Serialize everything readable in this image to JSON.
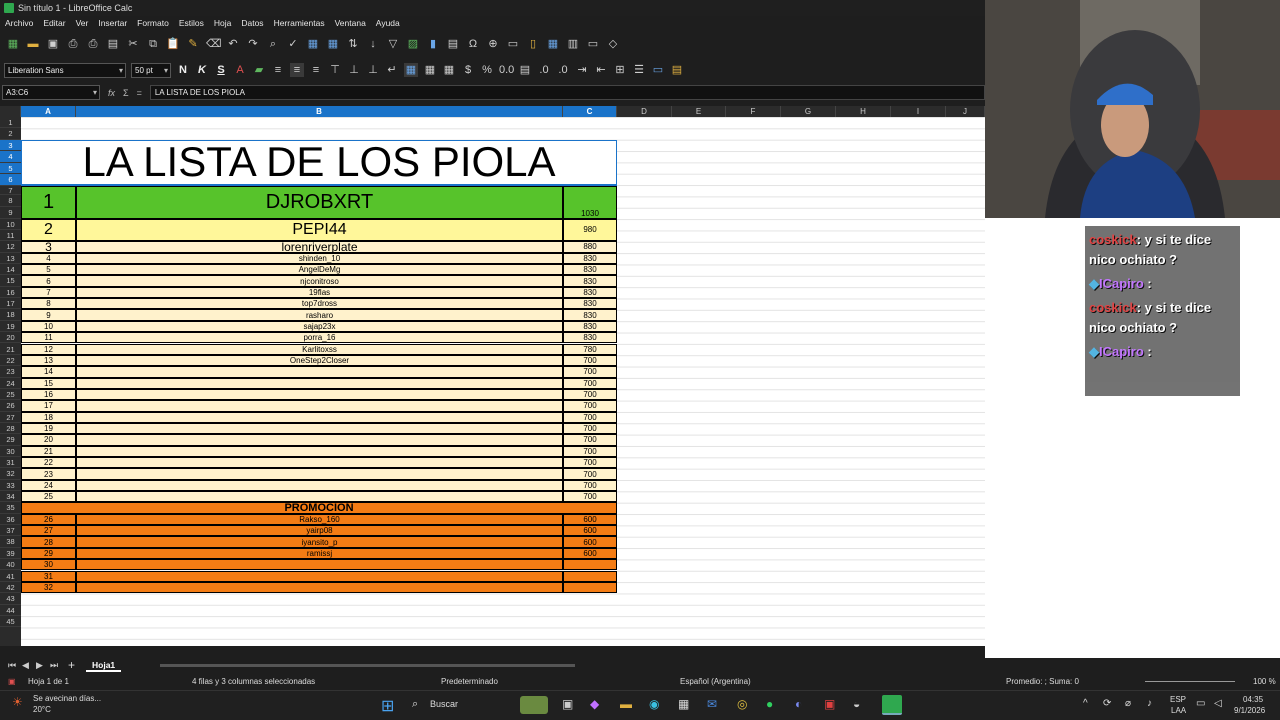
{
  "window": {
    "title": "Sin título 1 - LibreOffice Calc"
  },
  "menu": [
    "Archivo",
    "Editar",
    "Ver",
    "Insertar",
    "Formato",
    "Estilos",
    "Hoja",
    "Datos",
    "Herramientas",
    "Ventana",
    "Ayuda"
  ],
  "toolbar": {
    "font_name": "Liberation Sans",
    "font_size": "50 pt"
  },
  "formula": {
    "cell_ref": "A3:C6",
    "content": "LA LISTA DE LOS PIOLA"
  },
  "columns": [
    "A",
    "B",
    "C",
    "D",
    "E",
    "F",
    "G",
    "H",
    "I",
    "J"
  ],
  "rows": [
    "1",
    "2",
    "3",
    "4",
    "5",
    "6",
    "7",
    "8",
    "9",
    "10",
    "11",
    "12",
    "13",
    "14",
    "15",
    "16",
    "17",
    "18",
    "19",
    "20",
    "21",
    "22",
    "23",
    "24",
    "25",
    "26",
    "27",
    "28",
    "29",
    "30",
    "31",
    "32",
    "33",
    "34",
    "35",
    "36",
    "37",
    "38",
    "39",
    "40",
    "41",
    "42",
    "43",
    "44",
    "45"
  ],
  "sheet": {
    "title": "LA LISTA DE LOS PIOLA",
    "top3": [
      {
        "rank": "1",
        "name": "DJROBXRT",
        "score": "1030"
      },
      {
        "rank": "2",
        "name": "PEPI44",
        "score": "980"
      },
      {
        "rank": "3",
        "name": "lorenriverplate",
        "score": "880"
      }
    ],
    "list": [
      {
        "rank": "4",
        "name": "shinden_10",
        "score": "830"
      },
      {
        "rank": "5",
        "name": "AngelDeMg",
        "score": "830"
      },
      {
        "rank": "6",
        "name": "njconitroso",
        "score": "830"
      },
      {
        "rank": "7",
        "name": "19flas",
        "score": "830"
      },
      {
        "rank": "8",
        "name": "top7dross",
        "score": "830"
      },
      {
        "rank": "9",
        "name": "rasharo",
        "score": "830"
      },
      {
        "rank": "10",
        "name": "sajap23x",
        "score": "830"
      },
      {
        "rank": "11",
        "name": "porra_16",
        "score": "830"
      },
      {
        "rank": "12",
        "name": "Karlitoxss",
        "score": "780"
      },
      {
        "rank": "13",
        "name": "OneStep2Closer",
        "score": "700"
      },
      {
        "rank": "14",
        "name": "",
        "score": "700"
      },
      {
        "rank": "15",
        "name": "",
        "score": "700"
      },
      {
        "rank": "16",
        "name": "",
        "score": "700"
      },
      {
        "rank": "17",
        "name": "",
        "score": "700"
      },
      {
        "rank": "18",
        "name": "",
        "score": "700"
      },
      {
        "rank": "19",
        "name": "",
        "score": "700"
      },
      {
        "rank": "20",
        "name": "",
        "score": "700"
      },
      {
        "rank": "21",
        "name": "",
        "score": "700"
      },
      {
        "rank": "22",
        "name": "",
        "score": "700"
      },
      {
        "rank": "23",
        "name": "",
        "score": "700"
      },
      {
        "rank": "24",
        "name": "",
        "score": "700"
      },
      {
        "rank": "25",
        "name": "",
        "score": "700"
      }
    ],
    "promo_title": "PROMOCION",
    "promo": [
      {
        "rank": "26",
        "name": "Rakso_160",
        "score": "600"
      },
      {
        "rank": "27",
        "name": "yairp08",
        "score": "600"
      },
      {
        "rank": "28",
        "name": "iyansito_p",
        "score": "600"
      },
      {
        "rank": "29",
        "name": "ramissj",
        "score": "600"
      },
      {
        "rank": "30",
        "name": "",
        "score": ""
      },
      {
        "rank": "31",
        "name": "",
        "score": ""
      },
      {
        "rank": "32",
        "name": "",
        "score": ""
      }
    ]
  },
  "tabs": {
    "sheet_name": "Hoja1"
  },
  "status": {
    "sheet": "Hoja 1 de 1",
    "selection": "4 filas y 3 columnas seleccionadas",
    "style": "Predeterminado",
    "lang": "Español (Argentina)",
    "sum": "Promedio: ; Suma: 0",
    "zoom": "100 %"
  },
  "chat": [
    {
      "user": "coskick",
      "text": ": y si te dice nico ochiato ?"
    },
    {
      "user": "ICapiro",
      "text": " :"
    },
    {
      "user": "coskick",
      "text": ": y si te dice nico ochiato ?"
    },
    {
      "user": "ICapiro",
      "text": " :"
    }
  ],
  "taskbar": {
    "weather_text": "Se avecinan días...",
    "weather_temp": "20°C",
    "search": "Buscar",
    "lang1": "ESP",
    "lang2": "LAA",
    "time": "04:35",
    "date": "9/1/2026"
  },
  "colors": {
    "green": "#57c32b",
    "yellow": "#fff79a",
    "cream": "#fff2cc",
    "orange": "#f47c14",
    "selection": "#1a73c9"
  }
}
